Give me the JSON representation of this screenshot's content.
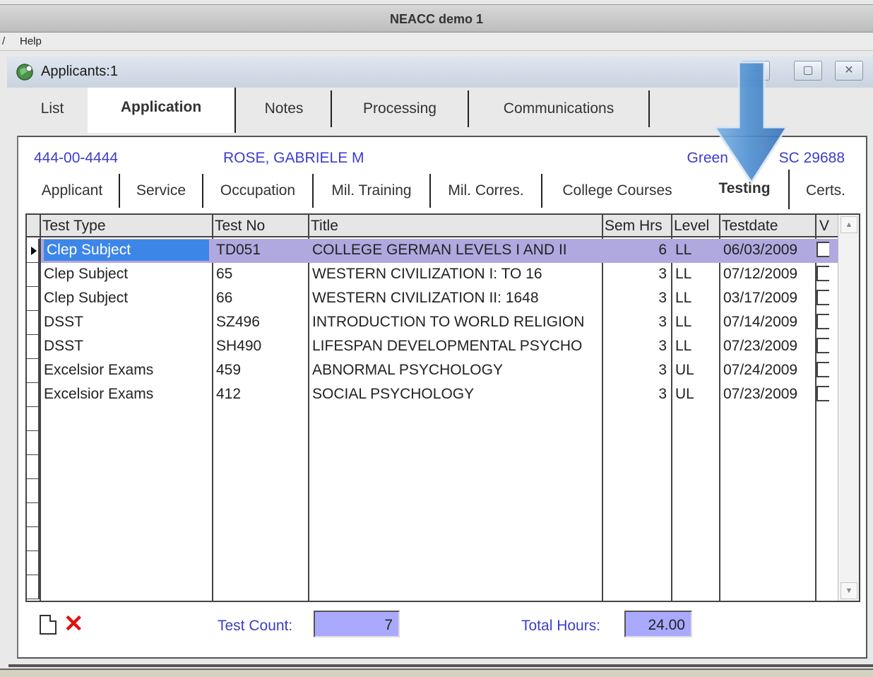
{
  "app": {
    "title": "NEACC demo 1"
  },
  "menu": {
    "fragment": "/",
    "help": "Help"
  },
  "window": {
    "title": "Applicants:1",
    "buttons": [
      "minimize",
      "maximize",
      "close"
    ]
  },
  "main_tabs": [
    {
      "label": "List",
      "active": false
    },
    {
      "label": "Application",
      "active": true
    },
    {
      "label": "Notes",
      "active": false
    },
    {
      "label": "Processing",
      "active": false
    },
    {
      "label": "Communications",
      "active": false
    }
  ],
  "applicant": {
    "ssn": "444-00-4444",
    "name": "ROSE, GABRIELE M",
    "city": "Green",
    "location_tail": "SC 29688"
  },
  "sub_tabs": [
    {
      "label": "Applicant",
      "active": false
    },
    {
      "label": "Service",
      "active": false
    },
    {
      "label": "Occupation",
      "active": false
    },
    {
      "label": "Mil. Training",
      "active": false
    },
    {
      "label": "Mil. Corres.",
      "active": false
    },
    {
      "label": "College Courses",
      "active": false
    },
    {
      "label": "Testing",
      "active": true
    },
    {
      "label": "Certs.",
      "active": false
    }
  ],
  "table": {
    "columns": [
      "Test Type",
      "Test No",
      "Title",
      "Sem Hrs",
      "Level",
      "Testdate",
      "V"
    ],
    "rows": [
      {
        "test_type": "Clep Subject",
        "test_no": "TD051",
        "title": "COLLEGE GERMAN LEVELS I AND II",
        "sem_hrs": "6",
        "level": "LL",
        "testdate": "06/03/2009",
        "verified": false,
        "selected": true
      },
      {
        "test_type": "Clep Subject",
        "test_no": "65",
        "title": "WESTERN CIVILIZATION I:  TO 16",
        "sem_hrs": "3",
        "level": "LL",
        "testdate": "07/12/2009",
        "verified": false,
        "selected": false
      },
      {
        "test_type": "Clep Subject",
        "test_no": "66",
        "title": "WESTERN CIVILIZATION II:  1648",
        "sem_hrs": "3",
        "level": "LL",
        "testdate": "03/17/2009",
        "verified": false,
        "selected": false
      },
      {
        "test_type": "DSST",
        "test_no": "SZ496",
        "title": "INTRODUCTION TO WORLD RELIGION",
        "sem_hrs": "3",
        "level": "LL",
        "testdate": "07/14/2009",
        "verified": false,
        "selected": false
      },
      {
        "test_type": "DSST",
        "test_no": "SH490",
        "title": "LIFESPAN DEVELOPMENTAL PSYCHO",
        "sem_hrs": "3",
        "level": "LL",
        "testdate": "07/23/2009",
        "verified": false,
        "selected": false
      },
      {
        "test_type": "Excelsior Exams",
        "test_no": "459",
        "title": "ABNORMAL PSYCHOLOGY",
        "sem_hrs": "3",
        "level": "UL",
        "testdate": "07/24/2009",
        "verified": false,
        "selected": false
      },
      {
        "test_type": "Excelsior Exams",
        "test_no": "412",
        "title": "SOCIAL PSYCHOLOGY",
        "sem_hrs": "3",
        "level": "UL",
        "testdate": "07/23/2009",
        "verified": false,
        "selected": false
      }
    ]
  },
  "footer": {
    "new_icon": "new-record-icon",
    "delete_icon": "delete-x-icon",
    "test_count_label": "Test Count:",
    "test_count_value": "7",
    "total_hours_label": "Total Hours:",
    "total_hours_value": "24.00"
  },
  "colors": {
    "accent_text": "#3c3ccc",
    "selected_row": "#b0a9e0",
    "selected_cell": "#3d86e8",
    "summary_box": "#a9a9ff",
    "delete_icon": "#e01010",
    "annotation_arrow": "#5b9bd5"
  }
}
